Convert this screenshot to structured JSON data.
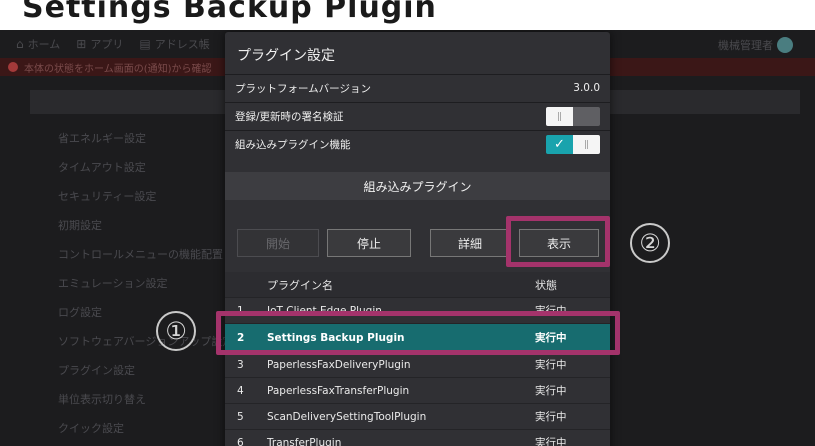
{
  "heading": "Settings Backup Plugin",
  "topbar": {
    "items": [
      "ホーム",
      "アプリ",
      "アドレス帳"
    ],
    "admin_label": "機械管理者"
  },
  "alert": {
    "text": "本体の状態をホーム画面の(通知)から確認"
  },
  "left_menu": [
    "省エネルギー設定",
    "タイムアウト設定",
    "セキュリティー設定",
    "初期設定",
    "コントロールメニューの機能配置",
    "エミュレーション設定",
    "ログ設定",
    "ソフトウェアバージョンアップ設定",
    "プラグイン設定",
    "単位表示切り替え",
    "クイック設定"
  ],
  "dialog": {
    "title": "プラグイン設定",
    "platform_version_label": "プラットフォームバージョン",
    "platform_version_value": "3.0.0",
    "signature_label": "登録/更新時の署名検証",
    "signature_toggle": "off",
    "builtin_label": "組み込みプラグイン機能",
    "builtin_toggle": "on",
    "section_title": "組み込みプラグイン",
    "buttons": {
      "start": "開始",
      "stop": "停止",
      "details": "詳細",
      "show": "表示"
    },
    "table": {
      "col_name": "プラグイン名",
      "col_status": "状態",
      "rows": [
        {
          "no": "1",
          "name": "IoT Client Edge Plugin",
          "status": "実行中"
        },
        {
          "no": "2",
          "name": "Settings Backup Plugin",
          "status": "実行中"
        },
        {
          "no": "3",
          "name": "PaperlessFaxDeliveryPlugin",
          "status": "実行中"
        },
        {
          "no": "4",
          "name": "PaperlessFaxTransferPlugin",
          "status": "実行中"
        },
        {
          "no": "5",
          "name": "ScanDeliverySettingToolPlugin",
          "status": "実行中"
        },
        {
          "no": "6",
          "name": "TransferPlugin",
          "status": "実行中"
        }
      ]
    }
  },
  "annotations": {
    "one": "①",
    "two": "②"
  },
  "colors": {
    "highlight": "#a4336b",
    "selected_row": "#176c6f",
    "toggle_on": "#19a3ad"
  }
}
